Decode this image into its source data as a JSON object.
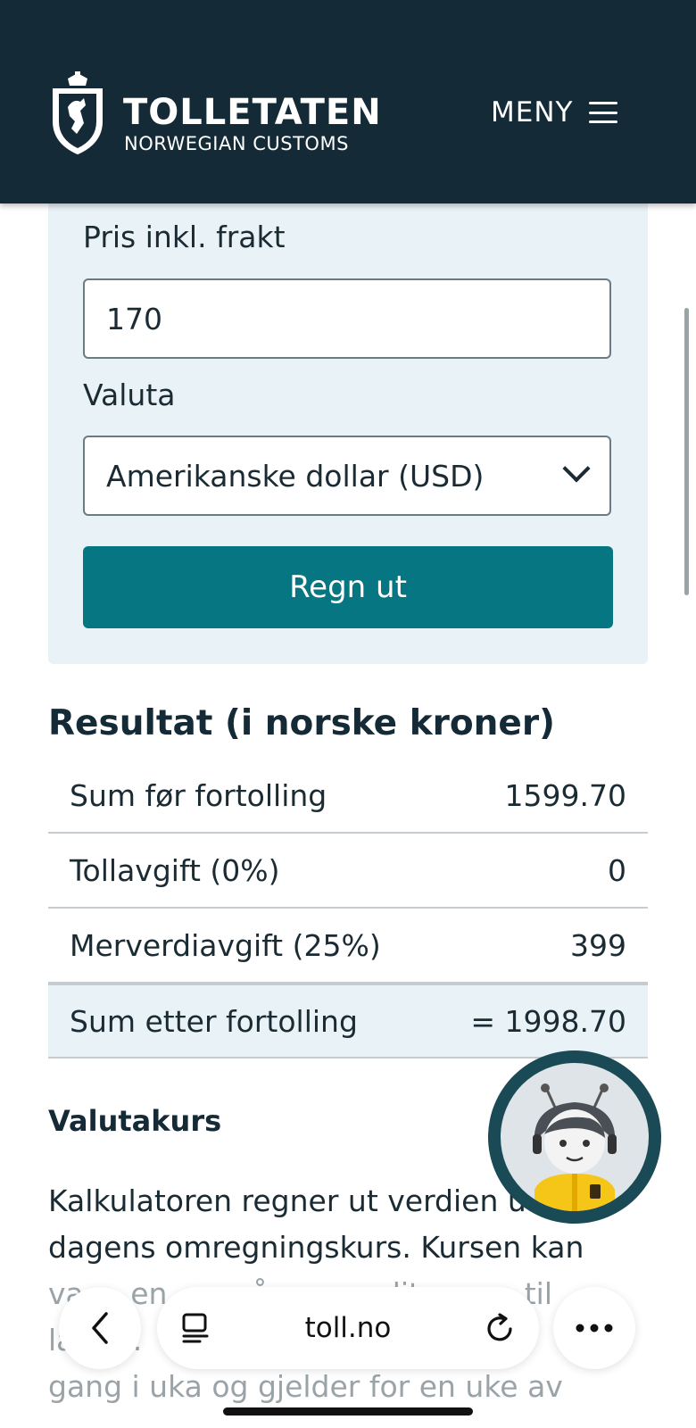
{
  "header": {
    "brand_title": "TOLLETATEN",
    "brand_subtitle": "NORWEGIAN CUSTOMS",
    "menu_label": "MENY",
    "background": "#142a36"
  },
  "form": {
    "price_label": "Pris inkl. frakt",
    "price_value": "170",
    "currency_label": "Valuta",
    "currency_selected": "Amerikanske dollar (USD)",
    "calc_button": "Regn ut",
    "button_color": "#067682"
  },
  "result": {
    "title": "Resultat (i norske kroner)",
    "rows": [
      {
        "label": "Sum før fortolling",
        "value": "1599.70"
      },
      {
        "label": "Tollavgift (0%)",
        "value": "0"
      },
      {
        "label": "Merverdiavgift (25%)",
        "value": "399"
      },
      {
        "label": "Sum etter fortolling",
        "value": "= 1998.70"
      }
    ]
  },
  "exchange": {
    "heading": "Valutakurs",
    "line1": "Kalkulatoren regner ut verdien ut",
    "line2": "dagens omregningskurs. Kursen kan",
    "line3": "va     en         å            dit  mm   til",
    "line4": "la     t.  .                          na",
    "line5": "gang i uka og gjelder for en uke av"
  },
  "browser": {
    "url": "toll.no"
  }
}
